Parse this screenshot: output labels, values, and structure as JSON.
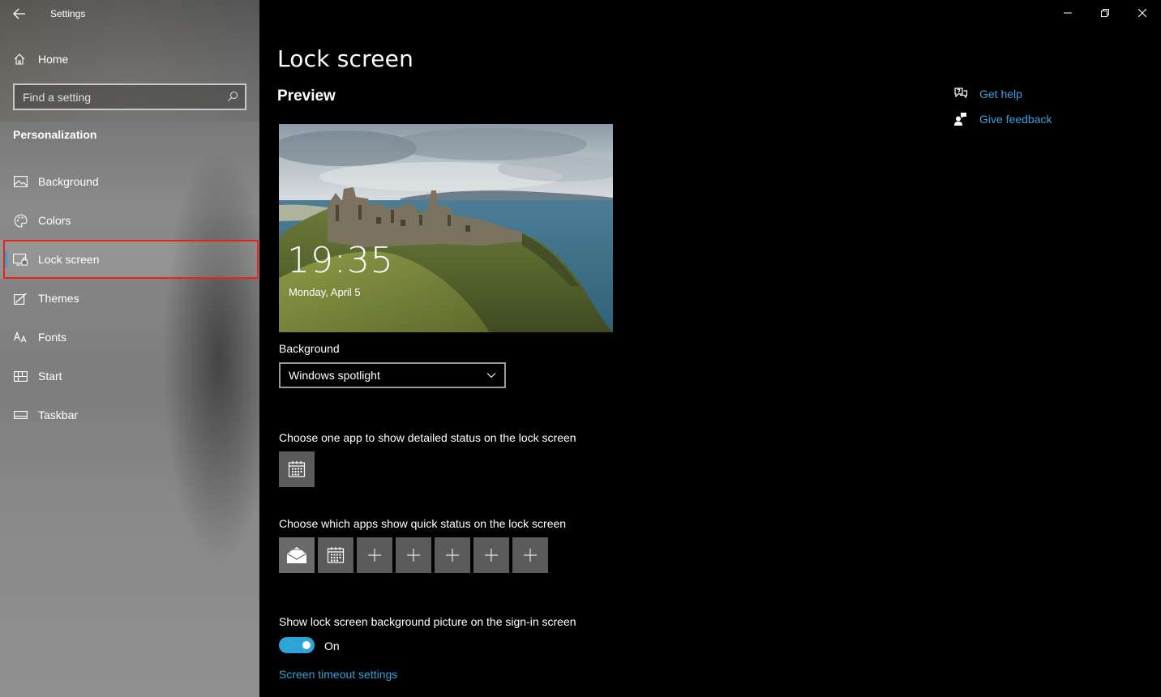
{
  "app": {
    "title": "Settings"
  },
  "sidebar": {
    "home_label": "Home",
    "search_placeholder": "Find a setting",
    "section_title": "Personalization",
    "items": [
      {
        "label": "Background",
        "icon": "picture-icon",
        "selected": false
      },
      {
        "label": "Colors",
        "icon": "palette-icon",
        "selected": false
      },
      {
        "label": "Lock screen",
        "icon": "lock-screen-icon",
        "selected": true
      },
      {
        "label": "Themes",
        "icon": "brush-icon",
        "selected": false
      },
      {
        "label": "Fonts",
        "icon": "fonts-icon",
        "selected": false
      },
      {
        "label": "Start",
        "icon": "start-icon",
        "selected": false
      },
      {
        "label": "Taskbar",
        "icon": "taskbar-icon",
        "selected": false
      }
    ]
  },
  "main": {
    "title": "Lock screen",
    "preview_title": "Preview",
    "preview": {
      "time": "19:35",
      "date": "Monday, April 5"
    },
    "background_label": "Background",
    "background_value": "Windows spotlight",
    "detailed_status_label": "Choose one app to show detailed status on the lock screen",
    "detailed_status_app": "calendar-icon",
    "quick_status_label": "Choose which apps show quick status on the lock screen",
    "quick_status_apps": [
      "mail-icon",
      "calendar-icon",
      "plus-icon",
      "plus-icon",
      "plus-icon",
      "plus-icon",
      "plus-icon"
    ],
    "signin_label": "Show lock screen background picture on the sign-in screen",
    "signin_toggle": "On",
    "timeout_link": "Screen timeout settings"
  },
  "help": {
    "get_help": "Get help",
    "give_feedback": "Give feedback"
  },
  "colors": {
    "accent": "#2ea3d6",
    "link": "#3ba0db",
    "highlight_outline": "#e8231f"
  }
}
